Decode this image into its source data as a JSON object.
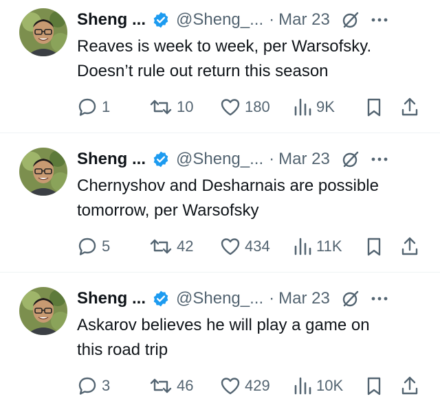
{
  "tweets": [
    {
      "author_name": "Sheng ...",
      "handle": "@Sheng_...",
      "separator": "·",
      "date": "Mar 23",
      "text_line1": "Reaves is week to week, per Warsofsky.",
      "text_line2": "Doesn’t rule out return this season",
      "replies": "1",
      "reposts": "10",
      "likes": "180",
      "views": "9K"
    },
    {
      "author_name": "Sheng ...",
      "handle": "@Sheng_...",
      "separator": "·",
      "date": "Mar 23",
      "text_line1": "Chernyshov and Desharnais are possible",
      "text_line2": "tomorrow, per Warsofsky",
      "replies": "5",
      "reposts": "42",
      "likes": "434",
      "views": "11K"
    },
    {
      "author_name": "Sheng ...",
      "handle": "@Sheng_...",
      "separator": "·",
      "date": "Mar 23",
      "text_line1": "Askarov believes he will play a game on",
      "text_line2": "this road trip",
      "replies": "3",
      "reposts": "46",
      "likes": "429",
      "views": "10K"
    }
  ],
  "icons": {
    "verified": "verified-badge-icon",
    "grok": "slashed-circle-icon",
    "more": "more-dots-icon",
    "reply": "reply-icon",
    "repost": "repost-icon",
    "like": "heart-icon",
    "views": "views-bar-chart-icon",
    "bookmark": "bookmark-icon",
    "share": "share-icon"
  },
  "colors": {
    "verified_blue": "#1d9bf0",
    "text": "#0f1419",
    "secondary": "#536471",
    "divider": "#eff3f4"
  }
}
